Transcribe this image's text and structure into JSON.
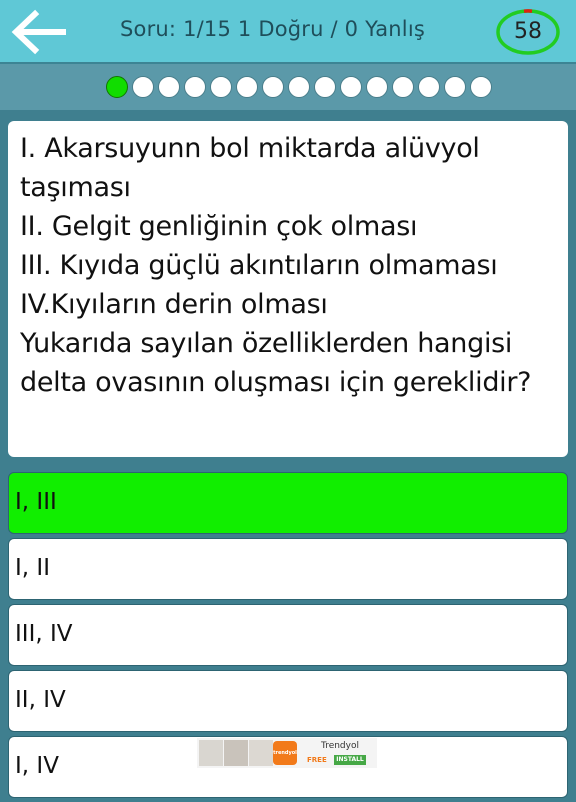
{
  "header": {
    "status": "Soru: 1/15  1 Doğru / 0  Yanlış",
    "timer": "58",
    "back_icon": "arrow-left-icon"
  },
  "progress": {
    "total": 15,
    "current": 1
  },
  "question": {
    "text": "I. Akarsuyunn bol miktarda alüvyol taşıması\nII. Gelgit genliğinin çok olması\nIII. Kıyıda güçlü akıntıların olmaması\nIV.Kıyıların derin olması\nYukarıda sayılan özelliklerden hangisi delta ovasının oluşması için gereklidir?"
  },
  "answers": [
    {
      "label": "I, III",
      "state": "correct"
    },
    {
      "label": "I, II",
      "state": "default"
    },
    {
      "label": "III, IV",
      "state": "default"
    },
    {
      "label": "II, IV",
      "state": "default"
    },
    {
      "label": "I, IV",
      "state": "default"
    }
  ],
  "ad": {
    "app_name": "Trendyol",
    "free_label": "FREE",
    "install_label": "INSTALL",
    "logo_text": "trendyol"
  },
  "colors": {
    "header_bg": "#5fc8d6",
    "accent_green": "#11ee00",
    "timer_ring_green": "#22cc22",
    "timer_ring_red": "#dd2211"
  }
}
